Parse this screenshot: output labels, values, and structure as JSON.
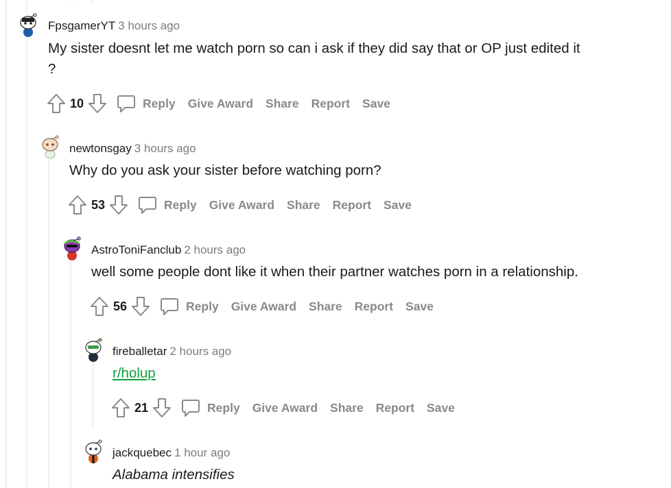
{
  "comments": [
    {
      "username": "FpsgamerYT",
      "time": "3 hours ago",
      "body_line1": "My sister doesnt let me watch porn so can i ask if they did say that or OP just edited it",
      "body_line2": "?",
      "score": "10",
      "actions": {
        "reply": "Reply",
        "award": "Give Award",
        "share": "Share",
        "report": "Report",
        "save": "Save"
      }
    },
    {
      "username": "newtonsgay",
      "time": "3 hours ago",
      "body_line1": "Why do you ask your sister before watching porn?",
      "score": "53",
      "actions": {
        "reply": "Reply",
        "award": "Give Award",
        "share": "Share",
        "report": "Report",
        "save": "Save"
      }
    },
    {
      "username": "AstroToniFanclub",
      "time": "2 hours ago",
      "body_line1": "well some people dont like it when their partner watches porn in a relationship.",
      "score": "56",
      "actions": {
        "reply": "Reply",
        "award": "Give Award",
        "share": "Share",
        "report": "Report",
        "save": "Save"
      }
    },
    {
      "username": "fireballetar",
      "time": "2 hours ago",
      "body_line1": "r/holup",
      "score": "21",
      "actions": {
        "reply": "Reply",
        "award": "Give Award",
        "share": "Share",
        "report": "Report",
        "save": "Save"
      }
    },
    {
      "username": "jackquebec",
      "time": "1 hour ago",
      "body_line1": "Alabama intensifies"
    }
  ],
  "colors": {
    "link": "#0d9f3e",
    "muted": "#878a8c",
    "thread_line": "#edeff1"
  }
}
